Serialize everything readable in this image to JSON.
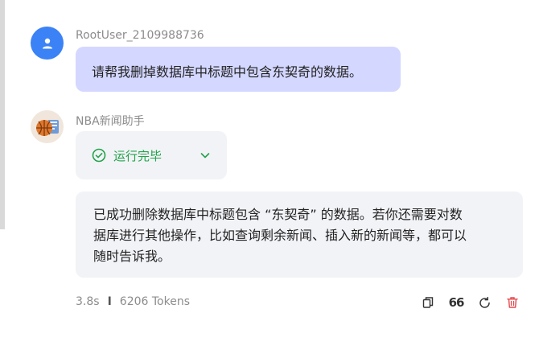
{
  "user": {
    "name": "RootUser_2109988736",
    "avatar_icon": "user-icon",
    "message": "请帮我删掉数据库中标题中包含东契奇的数据。"
  },
  "bot": {
    "name": "NBA新闻助手",
    "avatar_icon": "basketball-icon",
    "status_label": "运行完毕",
    "response_lines": [
      "已成功删除数据库中标题包含 “东契奇” 的数据。若你还需要对数",
      "据库进行其他操作，比如查询剩余新闻、插入新的新闻等，都可以",
      "随时告诉我。"
    ]
  },
  "meta": {
    "duration": "3.8s",
    "tokens": "6206 Tokens"
  },
  "actions": {
    "quote_label": "66"
  },
  "colors": {
    "accent": "#3b82f6",
    "user_bubble": "#d4d7ff",
    "success": "#21a34a",
    "danger": "#e5484d"
  }
}
